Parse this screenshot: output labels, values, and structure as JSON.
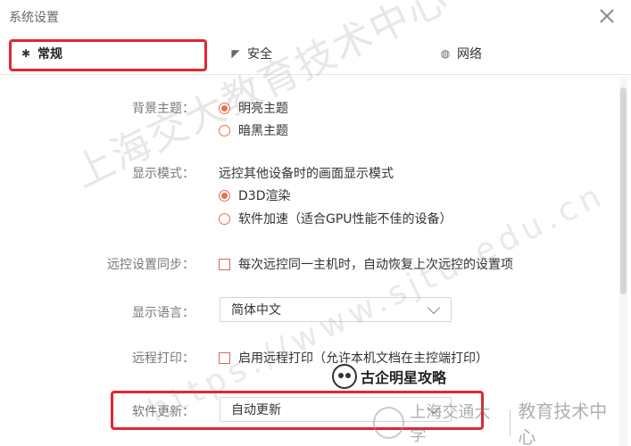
{
  "window": {
    "title": "系统设置"
  },
  "tabs": [
    {
      "label": "常规",
      "icon": "gear-icon"
    },
    {
      "label": "安全",
      "icon": "shield-icon"
    },
    {
      "label": "网络",
      "icon": "globe-icon"
    }
  ],
  "settings": {
    "theme": {
      "label": "背景主题：",
      "options": [
        "明亮主题",
        "暗黑主题"
      ],
      "selected": "明亮主题"
    },
    "display": {
      "label": "显示模式：",
      "description": "远控其他设备时的画面显示模式",
      "options": [
        "D3D渲染",
        "软件加速（适合GPU性能不佳的设备）"
      ],
      "selected": "D3D渲染"
    },
    "sync": {
      "label": "远控设置同步：",
      "checkbox": "每次远控同一主机时，自动恢复上次远控的设置项"
    },
    "language": {
      "label": "显示语言：",
      "value": "简体中文"
    },
    "printing": {
      "label": "远程打印：",
      "checkbox": "启用远程打印（允许本机文档在主控端打印）"
    },
    "update": {
      "label": "软件更新：",
      "value": "自动更新"
    }
  },
  "overlay": {
    "watermark_text": "上海交大教育技术中心",
    "watermark_url": "https://www.sjtu-edu.cn",
    "badge_text": "古企明星攻略",
    "logo_name": "上海交通大学",
    "logo_dept": "教育技术中心"
  },
  "colors": {
    "accent": "#e96e54",
    "highlight": "#e3262f"
  }
}
